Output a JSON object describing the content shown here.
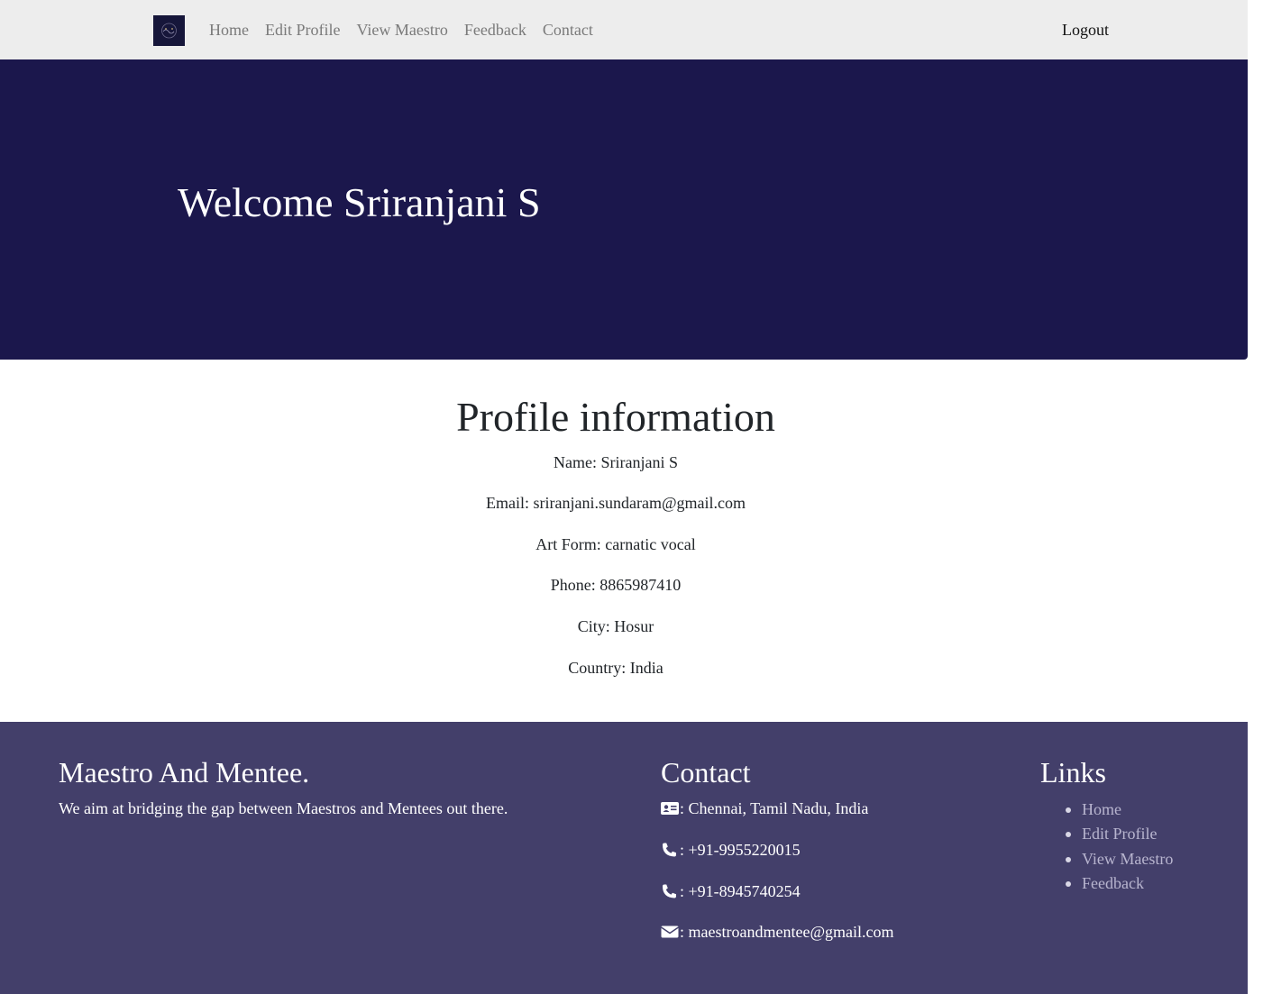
{
  "nav": {
    "logo_icon": "brand-logo-icon",
    "links": [
      "Home",
      "Edit Profile",
      "View Maestro",
      "Feedback",
      "Contact"
    ],
    "logout": "Logout"
  },
  "hero": {
    "title": "Welcome Sriranjani S"
  },
  "profile": {
    "title": "Profile information",
    "lines": [
      "Name: Sriranjani S",
      "Email: sriranjani.sundaram@gmail.com",
      "Art Form: carnatic vocal",
      "Phone: 8865987410",
      "City: Hosur",
      "Country: India"
    ]
  },
  "footer": {
    "brand_title": "Maestro And Mentee.",
    "tagline": "We aim at bridging the gap between Maestros and Mentees out there.",
    "contact_title": "Contact",
    "contact": [
      {
        "icon": "address-card-icon",
        "text": ": Chennai, Tamil Nadu, India"
      },
      {
        "icon": "phone-icon",
        "text": ": +91-9955220015"
      },
      {
        "icon": "phone-icon",
        "text": ": +91-8945740254"
      },
      {
        "icon": "envelope-icon",
        "text": ": maestroandmentee@gmail.com"
      }
    ],
    "links_title": "Links",
    "links": [
      "Home",
      "Edit Profile",
      "View Maestro",
      "Feedback"
    ]
  },
  "colors": {
    "navbar_bg": "#ededed",
    "hero_bg": "#1b174c",
    "footer_bg": "#433f6a",
    "footer_link": "#b8b5cf"
  }
}
